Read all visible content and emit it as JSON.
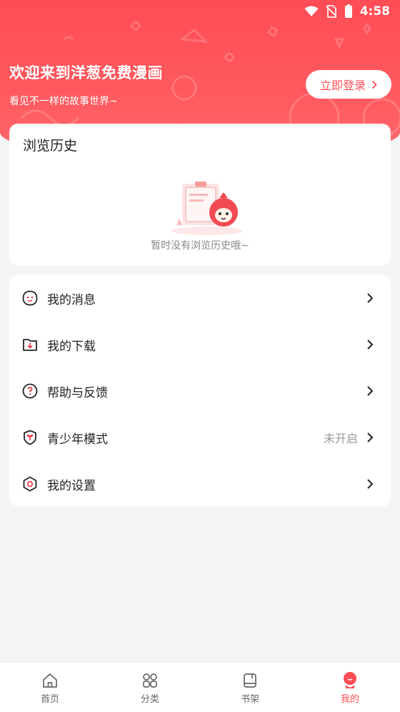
{
  "status_bar": {
    "time": "4:58"
  },
  "header": {
    "title": "欢迎来到洋葱免费漫画",
    "subtitle": "看见不一样的故事世界~",
    "login_label": "立即登录"
  },
  "history": {
    "title": "浏览历史",
    "empty_text": "暂时没有浏览历史哦~"
  },
  "menu": {
    "items": [
      {
        "label": "我的消息",
        "value": ""
      },
      {
        "label": "我的下载",
        "value": ""
      },
      {
        "label": "帮助与反馈",
        "value": ""
      },
      {
        "label": "青少年模式",
        "value": "未开启"
      },
      {
        "label": "我的设置",
        "value": ""
      }
    ]
  },
  "bottom_nav": {
    "items": [
      {
        "label": "首页",
        "icon": "home-icon"
      },
      {
        "label": "分类",
        "icon": "category-icon"
      },
      {
        "label": "书架",
        "icon": "bookshelf-icon"
      },
      {
        "label": "我的",
        "icon": "profile-icon"
      }
    ],
    "active_index": 3
  },
  "colors": {
    "accent": "#ff4d55",
    "background": "#f5f5f5",
    "card": "#ffffff"
  }
}
